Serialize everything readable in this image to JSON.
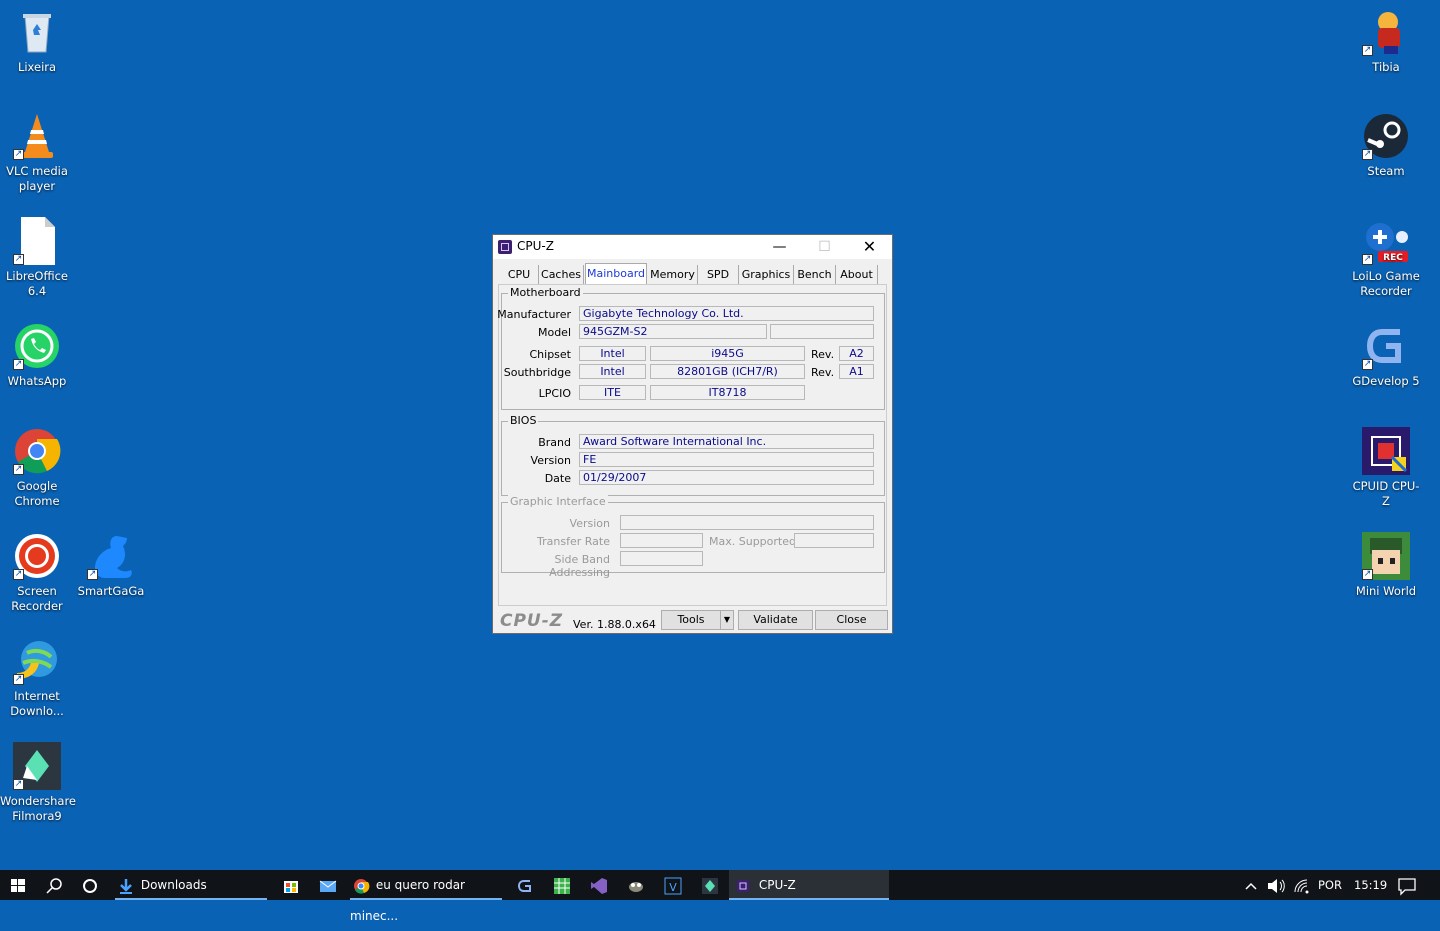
{
  "desktop": {
    "left_icons": [
      {
        "label": "Lixeira",
        "icon": "recycle-bin-icon"
      },
      {
        "label": "VLC media player",
        "icon": "vlc-icon"
      },
      {
        "label": "LibreOffice 6.4",
        "icon": "libreoffice-icon"
      },
      {
        "label": "WhatsApp",
        "icon": "whatsapp-icon"
      },
      {
        "label": "Google Chrome",
        "icon": "chrome-icon"
      },
      {
        "label": "Screen Recorder",
        "icon": "screen-recorder-icon"
      },
      {
        "label": "SmartGaGa",
        "icon": "smartgaga-icon"
      },
      {
        "label": "Internet Downlo...",
        "icon": "idm-icon"
      },
      {
        "label": "Wondershare Filmora9",
        "icon": "filmora-icon"
      }
    ],
    "right_icons": [
      {
        "label": "Tibia",
        "icon": "tibia-icon"
      },
      {
        "label": "Steam",
        "icon": "steam-icon"
      },
      {
        "label": "LoiLo Game Recorder",
        "icon": "loilo-icon"
      },
      {
        "label": "GDevelop 5",
        "icon": "gdevelop-icon"
      },
      {
        "label": "CPUID CPU-Z",
        "icon": "cpuz-icon"
      },
      {
        "label": "Mini World",
        "icon": "miniworld-icon"
      }
    ]
  },
  "window": {
    "title": "CPU-Z",
    "tabs": [
      "CPU",
      "Caches",
      "Mainboard",
      "Memory",
      "SPD",
      "Graphics",
      "Bench",
      "About"
    ],
    "active_tab": "Mainboard",
    "motherboard": {
      "title": "Motherboard",
      "manufacturer_label": "Manufacturer",
      "manufacturer": "Gigabyte Technology Co. Ltd.",
      "model_label": "Model",
      "model": "945GZM-S2",
      "model_extra": "",
      "chipset_label": "Chipset",
      "chipset_vendor": "Intel",
      "chipset_name": "i945G",
      "chipset_rev_label": "Rev.",
      "chipset_rev": "A2",
      "southbridge_label": "Southbridge",
      "southbridge_vendor": "Intel",
      "southbridge_name": "82801GB (ICH7/R)",
      "southbridge_rev_label": "Rev.",
      "southbridge_rev": "A1",
      "lpcio_label": "LPCIO",
      "lpcio_vendor": "ITE",
      "lpcio_name": "IT8718"
    },
    "bios": {
      "title": "BIOS",
      "brand_label": "Brand",
      "brand": "Award Software International Inc.",
      "version_label": "Version",
      "version": "FE",
      "date_label": "Date",
      "date": "01/29/2007"
    },
    "graphic": {
      "title": "Graphic Interface",
      "version_label": "Version",
      "transfer_label": "Transfer Rate",
      "max_label": "Max. Supported",
      "sba_label": "Side Band Addressing"
    },
    "footer": {
      "logo": "CPU-Z",
      "version": "Ver. 1.88.0.x64",
      "tools": "Tools",
      "validate": "Validate",
      "close": "Close"
    }
  },
  "taskbar": {
    "downloads_label": "Downloads",
    "chrome_label": "eu quero rodar minec...",
    "cpuz_label": "CPU-Z",
    "language": "POR",
    "time": "15:19"
  }
}
